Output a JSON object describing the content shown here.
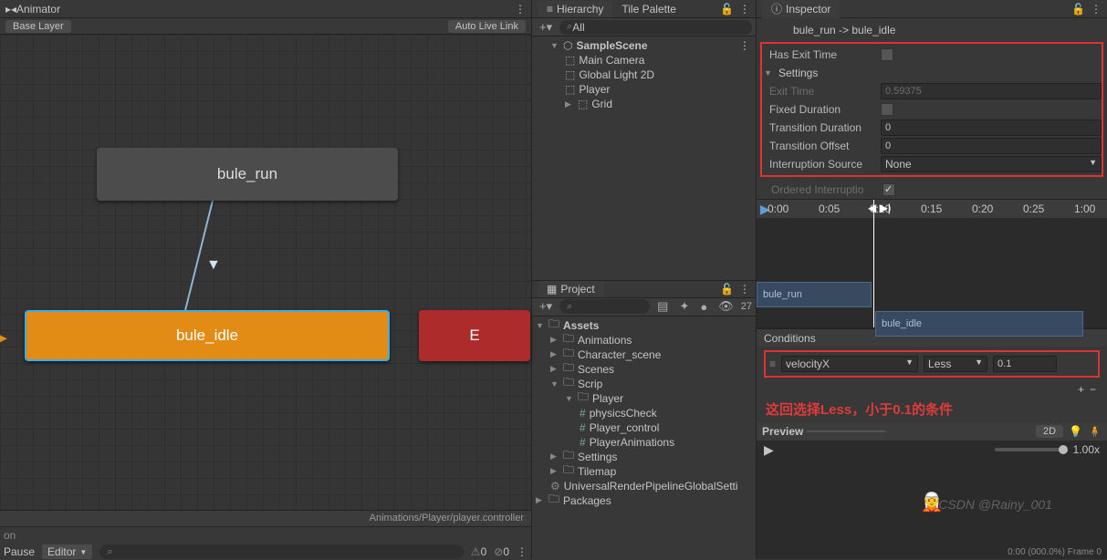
{
  "animator": {
    "title": "Animator",
    "layer": "Base Layer",
    "autoLiveLink": "Auto Live Link",
    "node_run": "bule_run",
    "node_idle": "bule_idle",
    "node_red": "E",
    "path": "Animations/Player/player.controller",
    "pauseLabel": "Pause",
    "editorLabel": "Editor",
    "onLabel": "on",
    "zero": "0"
  },
  "hierarchy": {
    "title": "Hierarchy",
    "tilePalette": "Tile Palette",
    "searchAll": "All",
    "scene": "SampleScene",
    "items": [
      "Main Camera",
      "Global Light 2D",
      "Player",
      "Grid"
    ]
  },
  "project": {
    "title": "Project",
    "count": "27",
    "root": "Assets",
    "folders": {
      "animations": "Animations",
      "character": "Character_scene",
      "scenes": "Scenes",
      "scrip": "Scrip",
      "player": "Player",
      "scripts": [
        "physicsCheck",
        "Player_control",
        "PlayerAnimations"
      ],
      "settings": "Settings",
      "tilemap": "Tilemap",
      "urp": "UniversalRenderPipelineGlobalSetti",
      "packages": "Packages"
    }
  },
  "inspector": {
    "title": "Inspector",
    "transition": "bule_run -> bule_idle",
    "hasExitTime": "Has Exit Time",
    "settings": "Settings",
    "exitTime": "Exit Time",
    "exitTimeVal": "0.59375",
    "fixedDuration": "Fixed Duration",
    "transDuration": "Transition Duration",
    "transDurationVal": "0",
    "transOffset": "Transition Offset",
    "transOffsetVal": "0",
    "interruptSource": "Interruption Source",
    "interruptSourceVal": "None",
    "orderedInterrupt": "Ordered Interruptio",
    "timeline": {
      "ticks": [
        "0:00",
        "0:05",
        "0:10",
        "0:15",
        "0:20",
        "0:25",
        "1:00"
      ],
      "clipRun": "bule_run",
      "clipIdle": "bule_idle"
    },
    "conditions": {
      "header": "Conditions",
      "param": "velocityX",
      "op": "Less",
      "val": "0.1"
    },
    "annotation": "这回选择Less，小于0.1的条件",
    "preview": {
      "label": "Preview",
      "d2": "2D",
      "zoom": "1.00x",
      "footer": "0:00 (000.0%) Frame 0"
    }
  },
  "watermark": "CSDN @Rainy_001"
}
